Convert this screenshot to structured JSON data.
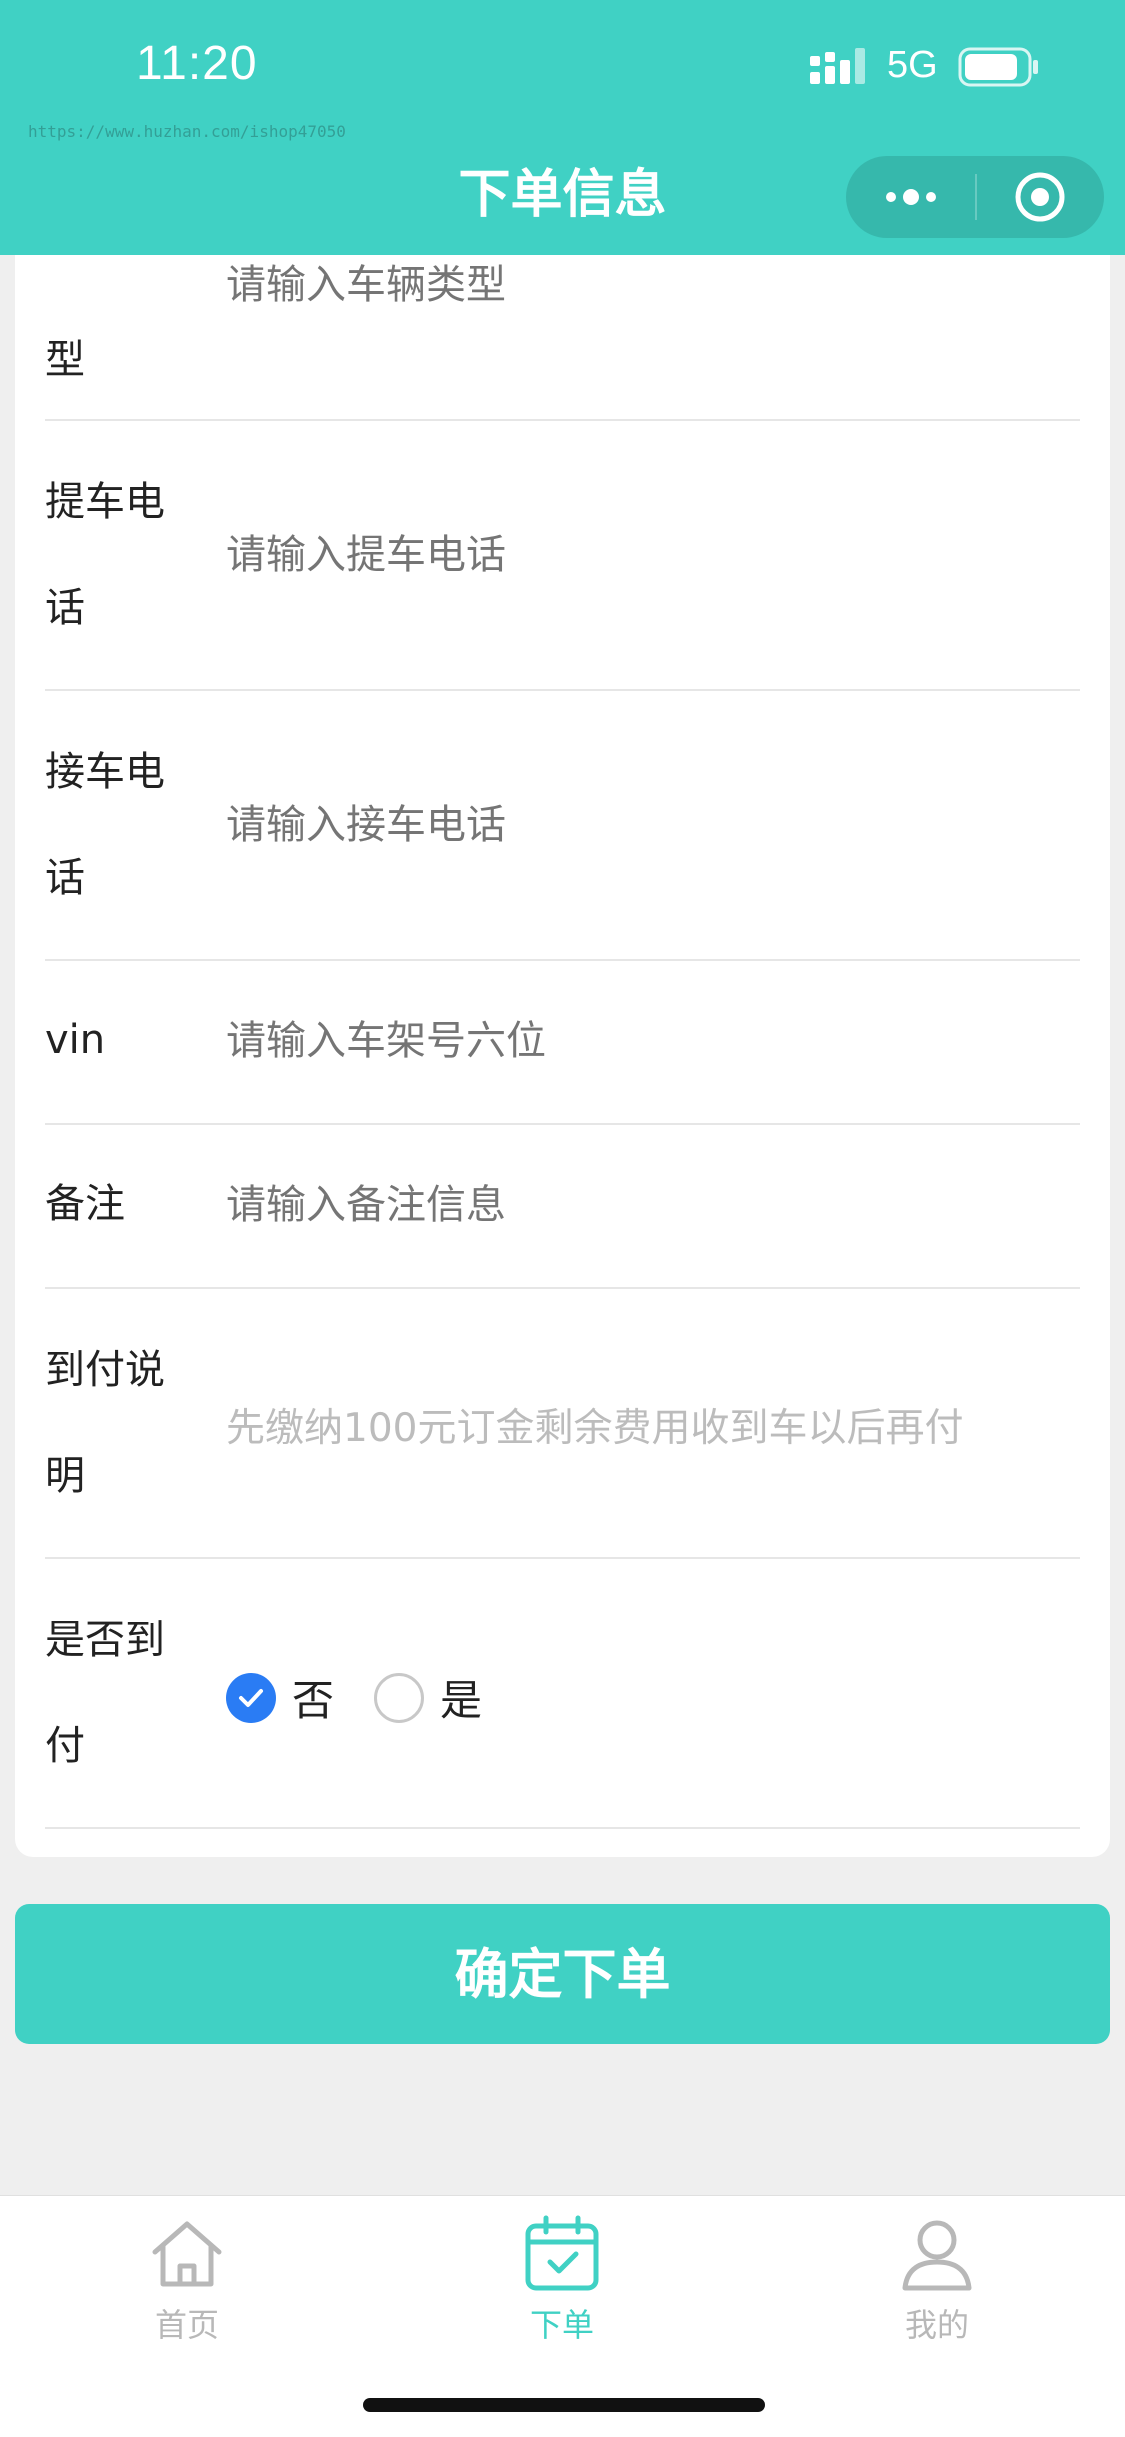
{
  "status_bar": {
    "time": "11:20",
    "network": "5G"
  },
  "watermark": "https://www.huzhan.com/ishop47050",
  "header": {
    "title": "下单信息"
  },
  "form": {
    "rows": [
      {
        "label": "型",
        "placeholder": "请输入车辆类型"
      },
      {
        "label": "提车电话",
        "placeholder": "请输入提车电话"
      },
      {
        "label": "接车电话",
        "placeholder": "请输入接车电话"
      },
      {
        "label": "vin",
        "placeholder": "请输入车架号六位"
      },
      {
        "label": "备注",
        "placeholder": "请输入备注信息"
      },
      {
        "label": "到付说明",
        "value": "先缴纳100元订金剩余费用收到车以后再付"
      },
      {
        "label": "是否到付",
        "options": [
          "否",
          "是"
        ],
        "selected": "否"
      }
    ]
  },
  "submit_label": "确定下单",
  "tabbar": {
    "items": [
      {
        "label": "首页",
        "icon": "home-icon",
        "active": false
      },
      {
        "label": "下单",
        "icon": "calendar-check-icon",
        "active": true
      },
      {
        "label": "我的",
        "icon": "user-icon",
        "active": false
      }
    ],
    "active_color": "#40d1c4",
    "inactive_color": "#b8b8b8"
  },
  "colors": {
    "brand": "#40d1c4",
    "radio_checked": "#2a7cf4"
  }
}
